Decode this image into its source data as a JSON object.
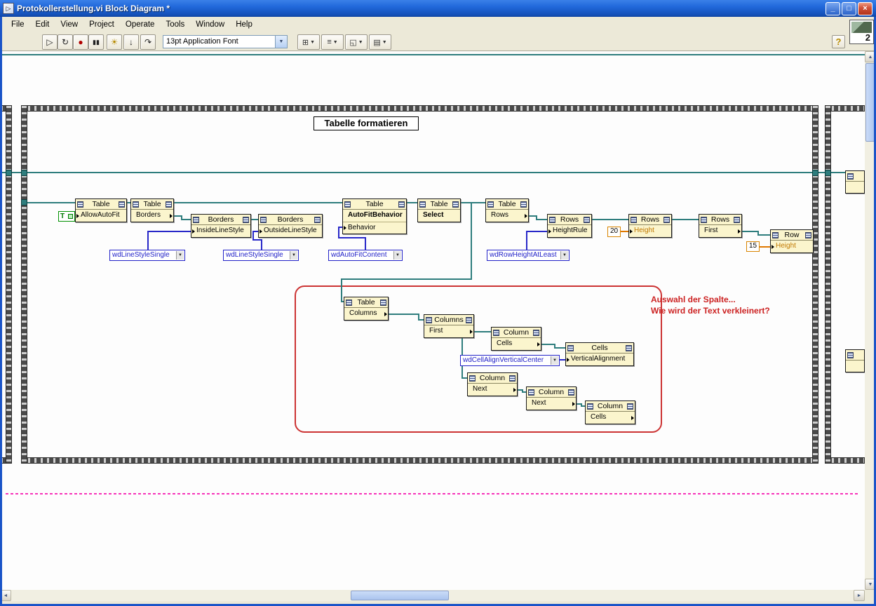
{
  "window": {
    "title": "Protokollerstellung.vi Block Diagram *",
    "controls": {
      "minimize": "_",
      "maximize": "□",
      "close": "×"
    },
    "icon_pane_count": "2"
  },
  "menu": {
    "items": [
      "File",
      "Edit",
      "View",
      "Project",
      "Operate",
      "Tools",
      "Window",
      "Help"
    ]
  },
  "toolbar": {
    "font_selector": "13pt Application Font",
    "help": "?",
    "buttons": [
      {
        "name": "run",
        "glyph": "▷"
      },
      {
        "name": "run-continuously",
        "glyph": "↻"
      },
      {
        "name": "abort",
        "glyph": "●"
      },
      {
        "name": "pause",
        "glyph": "▮▮"
      },
      {
        "name": "highlight-execution",
        "glyph": "☀"
      },
      {
        "name": "step-into",
        "glyph": "↓"
      },
      {
        "name": "step-over",
        "glyph": "↷"
      }
    ],
    "dropdowns": [
      {
        "name": "align-objects",
        "glyph": "⊞"
      },
      {
        "name": "distribute-objects",
        "glyph": "≡"
      },
      {
        "name": "resize-objects",
        "glyph": "◱"
      },
      {
        "name": "reorder-objects",
        "glyph": "▤"
      }
    ]
  },
  "icons": {
    "combo_arrow": "▼",
    "scroll_up": "▲",
    "scroll_down": "▼",
    "scroll_left": "◄",
    "scroll_right": "►"
  },
  "diagram": {
    "frame_label": "Tabelle formatieren",
    "comment_line1": "Auswahl der Spalte...",
    "comment_line2": "Wie wird der Text verkleinert?",
    "constants": {
      "bool_true": "T",
      "line_style_1": "wdLineStyleSingle",
      "line_style_2": "wdLineStyleSingle",
      "autofit_behavior": "wdAutoFitContent",
      "row_height_rule": "wdRowHeightAtLeast",
      "cell_vertical_alignment": "wdCellAlignVerticalCenter",
      "row_height_value": "20",
      "first_row_height_value": "15"
    },
    "nodes": [
      {
        "header": "Table",
        "rows": [
          "AllowAutoFit"
        ]
      },
      {
        "header": "Table",
        "rows": [
          "Borders"
        ]
      },
      {
        "header": "Borders",
        "rows": [
          "InsideLineStyle"
        ]
      },
      {
        "header": "Borders",
        "rows": [
          "OutsideLineStyle"
        ]
      },
      {
        "header": "Table",
        "rows": [
          "AutoFitBehavior",
          "Behavior"
        ]
      },
      {
        "header": "Table",
        "rows": [
          "Select"
        ]
      },
      {
        "header": "Table",
        "rows": [
          "Rows"
        ]
      },
      {
        "header": "Rows",
        "rows": [
          "HeightRule"
        ]
      },
      {
        "header": "Rows",
        "rows": [
          "Height"
        ]
      },
      {
        "header": "Rows",
        "rows": [
          "First"
        ]
      },
      {
        "header": "Row",
        "rows": [
          "Height"
        ]
      },
      {
        "header": "Table",
        "rows": [
          "Columns"
        ]
      },
      {
        "header": "Columns",
        "rows": [
          "First"
        ]
      },
      {
        "header": "Column",
        "rows": [
          "Cells"
        ]
      },
      {
        "header": "Cells",
        "rows": [
          "VerticalAlignment"
        ]
      },
      {
        "header": "Column",
        "rows": [
          "Next"
        ]
      },
      {
        "header": "Column",
        "rows": [
          "Next"
        ]
      },
      {
        "header": "Column",
        "rows": [
          "Cells"
        ]
      }
    ]
  }
}
